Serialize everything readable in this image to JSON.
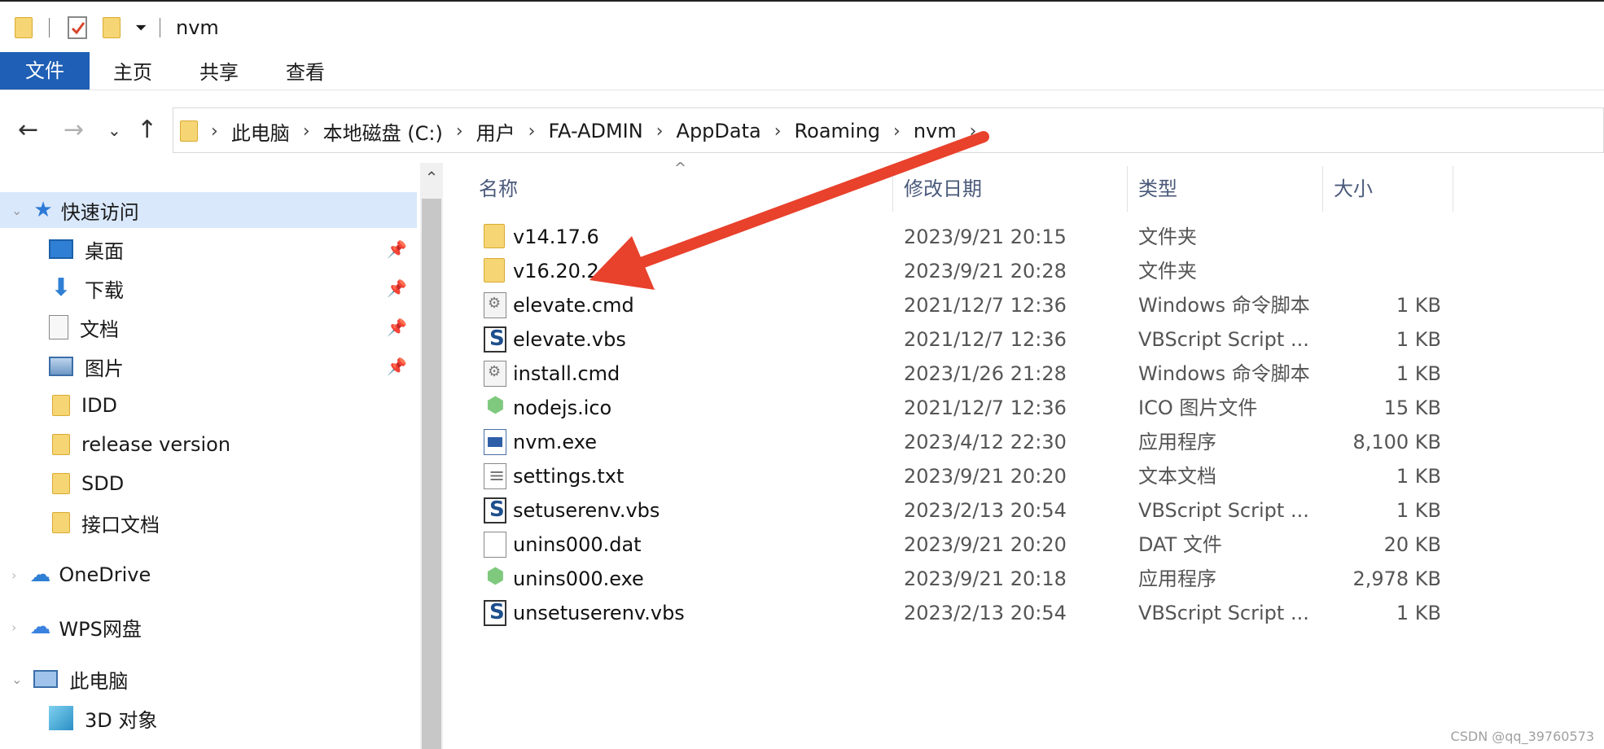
{
  "window": {
    "title": "nvm"
  },
  "ribbon": {
    "tabs": [
      "文件",
      "主页",
      "共享",
      "查看"
    ]
  },
  "nav": {
    "back_icon": "arrow-left-icon",
    "forward_icon": "arrow-right-icon",
    "recent_icon": "chevron-down-icon",
    "up_icon": "arrow-up-icon",
    "breadcrumbs": [
      "此电脑",
      "本地磁盘 (C:)",
      "用户",
      "FA-ADMIN",
      "AppData",
      "Roaming",
      "nvm"
    ]
  },
  "sidebar": {
    "quick_access": "快速访问",
    "items": [
      {
        "label": "桌面",
        "icon": "desktop-icon",
        "pinned": true
      },
      {
        "label": "下载",
        "icon": "download-icon",
        "pinned": true
      },
      {
        "label": "文档",
        "icon": "document-icon",
        "pinned": true
      },
      {
        "label": "图片",
        "icon": "picture-icon",
        "pinned": true
      },
      {
        "label": "IDD",
        "icon": "folder-icon",
        "pinned": false
      },
      {
        "label": "release version",
        "icon": "folder-icon",
        "pinned": false
      },
      {
        "label": "SDD",
        "icon": "folder-icon",
        "pinned": false
      },
      {
        "label": "接口文档",
        "icon": "folder-icon",
        "pinned": false
      }
    ],
    "onedrive": "OneDrive",
    "wps": "WPS网盘",
    "this_pc": "此电脑",
    "objects_3d": "3D 对象"
  },
  "columns": {
    "name": "名称",
    "modified": "修改日期",
    "type": "类型",
    "size": "大小"
  },
  "files": [
    {
      "name": "v14.17.6",
      "modified": "2023/9/21 20:15",
      "type": "文件夹",
      "size": "",
      "icon": "folder"
    },
    {
      "name": "v16.20.2",
      "modified": "2023/9/21 20:28",
      "type": "文件夹",
      "size": "",
      "icon": "folder"
    },
    {
      "name": "elevate.cmd",
      "modified": "2021/12/7 12:36",
      "type": "Windows 命令脚本",
      "size": "1 KB",
      "icon": "cmd"
    },
    {
      "name": "elevate.vbs",
      "modified": "2021/12/7 12:36",
      "type": "VBScript Script ...",
      "size": "1 KB",
      "icon": "vbs"
    },
    {
      "name": "install.cmd",
      "modified": "2023/1/26 21:28",
      "type": "Windows 命令脚本",
      "size": "1 KB",
      "icon": "cmd"
    },
    {
      "name": "nodejs.ico",
      "modified": "2021/12/7 12:36",
      "type": "ICO 图片文件",
      "size": "15 KB",
      "icon": "node"
    },
    {
      "name": "nvm.exe",
      "modified": "2023/4/12 22:30",
      "type": "应用程序",
      "size": "8,100 KB",
      "icon": "exe"
    },
    {
      "name": "settings.txt",
      "modified": "2023/9/21 20:20",
      "type": "文本文档",
      "size": "1 KB",
      "icon": "txt"
    },
    {
      "name": "setuserenv.vbs",
      "modified": "2023/2/13 20:54",
      "type": "VBScript Script ...",
      "size": "1 KB",
      "icon": "vbs"
    },
    {
      "name": "unins000.dat",
      "modified": "2023/9/21 20:20",
      "type": "DAT 文件",
      "size": "20 KB",
      "icon": "dat"
    },
    {
      "name": "unins000.exe",
      "modified": "2023/9/21 20:18",
      "type": "应用程序",
      "size": "2,978 KB",
      "icon": "node"
    },
    {
      "name": "unsetuserenv.vbs",
      "modified": "2023/2/13 20:54",
      "type": "VBScript Script ...",
      "size": "1 KB",
      "icon": "vbs"
    }
  ],
  "annotation": {
    "arrow_color": "#e8412c"
  },
  "watermark": "CSDN @qq_39760573"
}
